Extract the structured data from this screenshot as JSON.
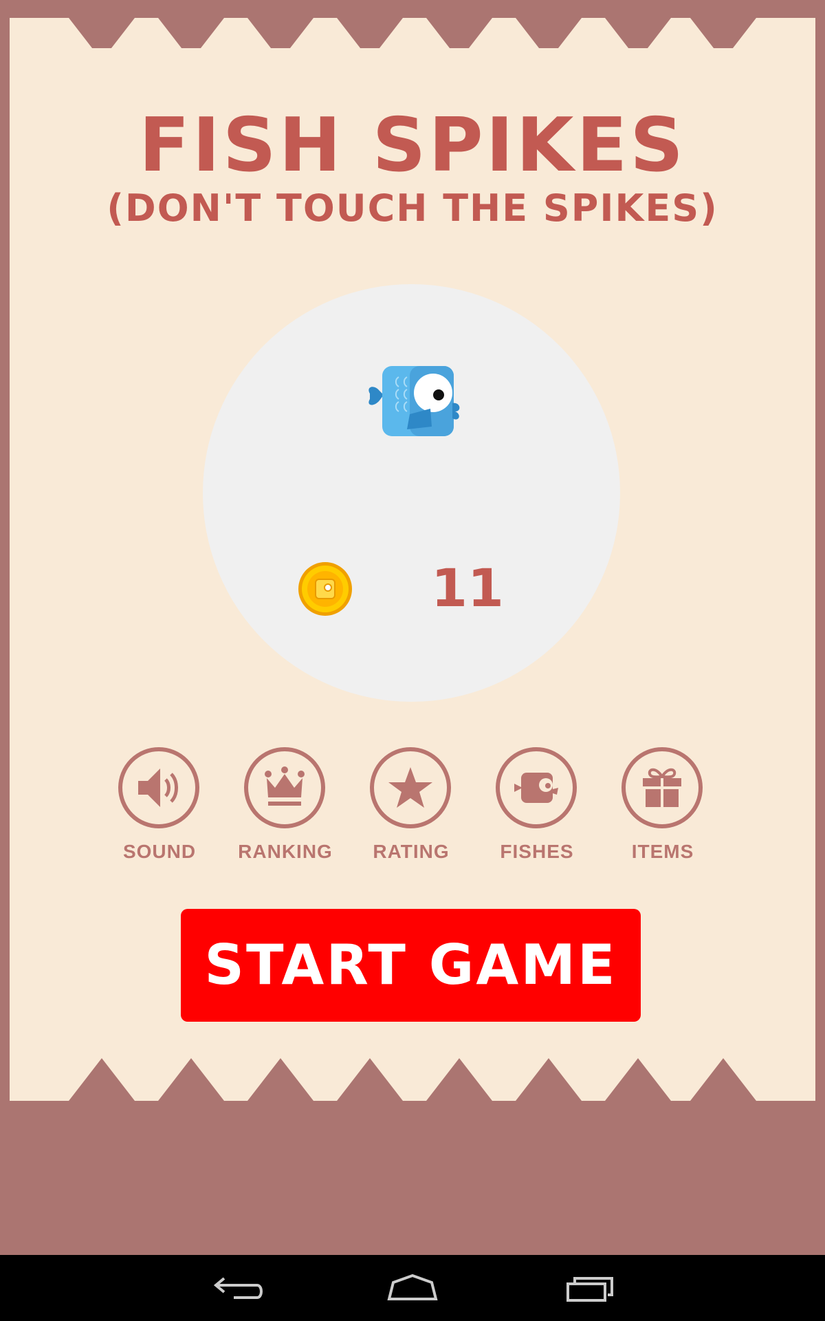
{
  "game": {
    "title": "FISH SPIKES",
    "subtitle": "(DON'T TOUCH THE SPIKES)"
  },
  "character": {
    "icon": "fish-icon"
  },
  "coins": {
    "icon": "coin-icon",
    "count": "11"
  },
  "menu": [
    {
      "label": "SOUND",
      "icon": "speaker-icon"
    },
    {
      "label": "RANKING",
      "icon": "crown-icon"
    },
    {
      "label": "RATING",
      "icon": "star-icon"
    },
    {
      "label": "FISHES",
      "icon": "fish-icon"
    },
    {
      "label": "ITEMS",
      "icon": "gift-icon"
    }
  ],
  "start_button": {
    "label": "START GAME"
  },
  "colors": {
    "frame": "#ab7571",
    "panel": "#f9ead7",
    "title": "#c25a52",
    "menu": "#b9756f",
    "start_button": "#ff0000",
    "circle": "#f0f0f0"
  },
  "system_nav": {
    "back_icon": "back-icon",
    "home_icon": "home-icon",
    "recents_icon": "recents-icon"
  }
}
